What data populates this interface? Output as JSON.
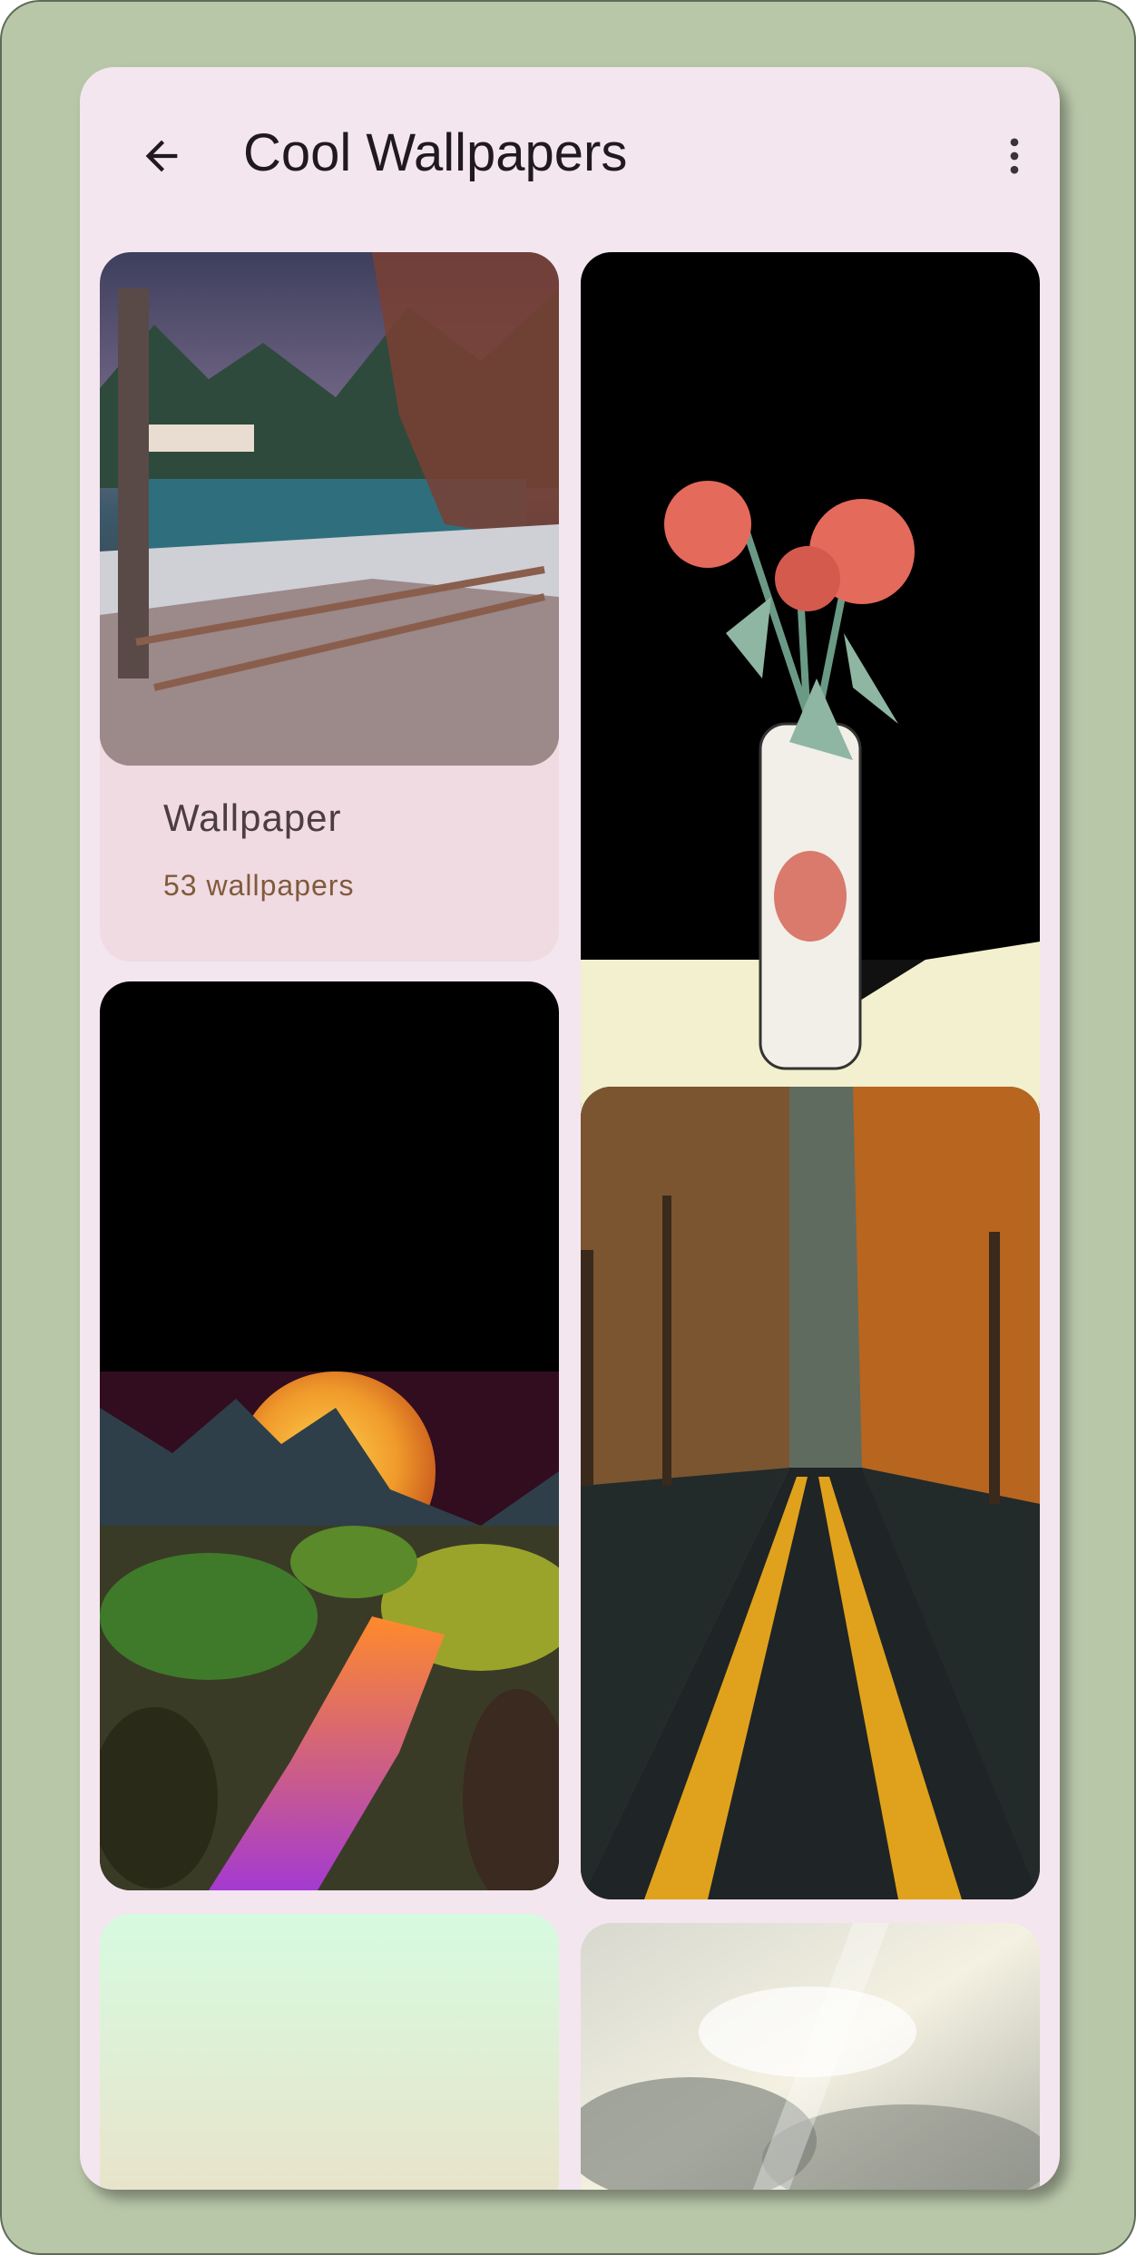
{
  "app": {
    "title": "Cool Wallpapers"
  },
  "topbar": {
    "back_icon": "arrow-left-icon",
    "menu_icon": "more-vert-icon"
  },
  "grid": {
    "category_card": {
      "title": "Wallpaper",
      "subtitle": "53 wallpapers"
    },
    "tiles": [
      {
        "name": "snowy-lake-forest",
        "column": "left"
      },
      {
        "name": "roses-in-vase",
        "column": "right"
      },
      {
        "name": "moon-over-mountains",
        "column": "left"
      },
      {
        "name": "autumn-road",
        "column": "right"
      },
      {
        "name": "mint-gradient",
        "column": "left"
      },
      {
        "name": "cloudy-sky",
        "column": "right"
      }
    ]
  },
  "colors": {
    "frame": "#b9c7a9",
    "surface": "#f3e6ee",
    "card": "#f0dbe2",
    "accent_text": "#7f5a3c"
  }
}
